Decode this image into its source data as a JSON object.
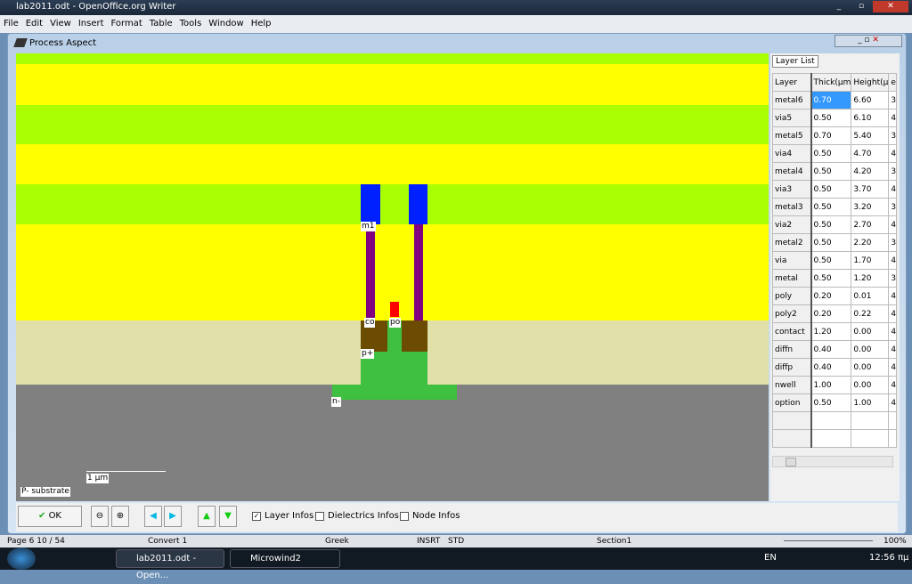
{
  "window": {
    "title": "lab2011.odt - OpenOffice.org Writer"
  },
  "menu": [
    "File",
    "Edit",
    "View",
    "Insert",
    "Format",
    "Table",
    "Tools",
    "Window",
    "Help"
  ],
  "dialog": {
    "title": "Process Aspect"
  },
  "canvas": {
    "labels": {
      "m1": "m1",
      "co": "co",
      "po": "po",
      "pplus": "p+",
      "nminus": "n-"
    },
    "scale": "1 µm",
    "substrate": "P- substrate",
    "colors": {
      "oxide_green": "#aaff00",
      "oxide_yellow": "#ffff00",
      "diffusion_beige": "#e0e0a8",
      "substrate": "#808080",
      "metal": "#0020ff",
      "via": "#800080",
      "poly": "#ff0000",
      "contact": "#6b4c00",
      "pdiff": "#40c040"
    }
  },
  "layer_list": {
    "tab": "Layer List",
    "headers": [
      "Layer",
      "Thick(µm",
      "Height(µ",
      "e"
    ],
    "rows": [
      [
        "metal6",
        "0.70",
        "6.60",
        "3"
      ],
      [
        "via5",
        "0.50",
        "6.10",
        "4"
      ],
      [
        "metal5",
        "0.70",
        "5.40",
        "3"
      ],
      [
        "via4",
        "0.50",
        "4.70",
        "4"
      ],
      [
        "metal4",
        "0.50",
        "4.20",
        "3"
      ],
      [
        "via3",
        "0.50",
        "3.70",
        "4"
      ],
      [
        "metal3",
        "0.50",
        "3.20",
        "3"
      ],
      [
        "via2",
        "0.50",
        "2.70",
        "4"
      ],
      [
        "metal2",
        "0.50",
        "2.20",
        "3"
      ],
      [
        "via",
        "0.50",
        "1.70",
        "4"
      ],
      [
        "metal",
        "0.50",
        "1.20",
        "3"
      ],
      [
        "poly",
        "0.20",
        "0.01",
        "4"
      ],
      [
        "poly2",
        "0.20",
        "0.22",
        "4"
      ],
      [
        "contact",
        "1.20",
        "0.00",
        "4"
      ],
      [
        "diffn",
        "0.40",
        "0.00",
        "4"
      ],
      [
        "diffp",
        "0.40",
        "0.00",
        "4"
      ],
      [
        "nwell",
        "1.00",
        "0.00",
        "4"
      ],
      [
        "option",
        "0.50",
        "1.00",
        "4"
      ],
      [
        "",
        "",
        "",
        ""
      ],
      [
        "",
        "",
        "",
        ""
      ]
    ]
  },
  "toolbar": {
    "ok": "OK",
    "layer_infos": "Layer Infos",
    "layer_infos_checked": true,
    "dielectrics_infos": "Dielectrics Infos",
    "dielectrics_infos_checked": false,
    "node_infos": "Node Infos",
    "node_infos_checked": false
  },
  "status": {
    "page": "Page 6   10 / 54",
    "style": "Convert 1",
    "lang": "Greek",
    "mode": "INSRT",
    "sel": "STD",
    "section": "Section1",
    "zoom": "100%"
  },
  "taskbar": {
    "tasks": [
      "lab2011.odt - Open...",
      "Microwind2"
    ],
    "lang": "EN",
    "time": "12:56 πμ"
  }
}
